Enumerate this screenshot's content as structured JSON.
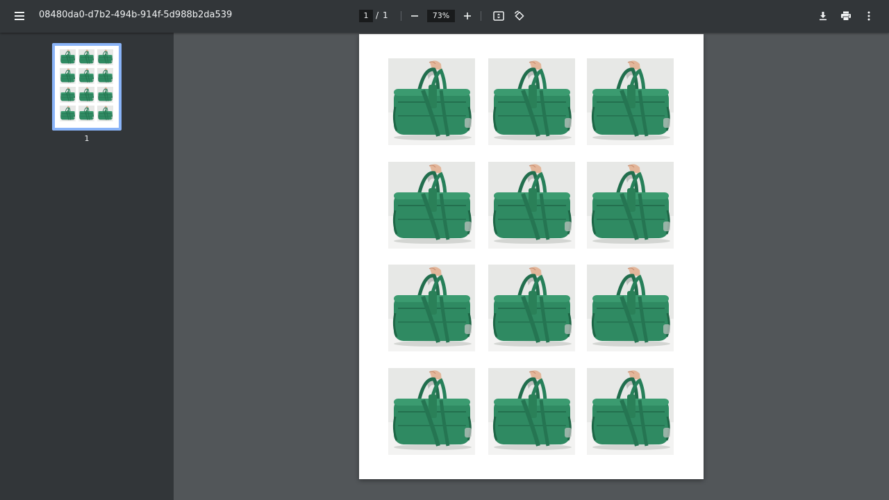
{
  "toolbar": {
    "title": "08480da0-d7b2-494b-914f-5d988b2da539",
    "current_page": "1",
    "page_separator": "/",
    "total_pages": "1",
    "zoom": "73%",
    "icons": {
      "menu": "hamburger-menu-icon",
      "zoom_out": "minus-icon",
      "zoom_in": "plus-icon",
      "fit": "fit-to-page-icon",
      "rotate": "rotate-icon",
      "download": "download-icon",
      "print": "print-icon",
      "more": "more-vertical-icon"
    }
  },
  "sidebar": {
    "thumbnails": [
      {
        "label": "1",
        "selected": true
      }
    ]
  },
  "document": {
    "image_rows": 4,
    "image_cols": 3,
    "image_subject": "green duffel bag held by hand"
  },
  "colors": {
    "toolbar_bg": "#323639",
    "viewer_bg": "#525659",
    "selection": "#8ab4f8",
    "bag_green": "#2f8a62"
  }
}
